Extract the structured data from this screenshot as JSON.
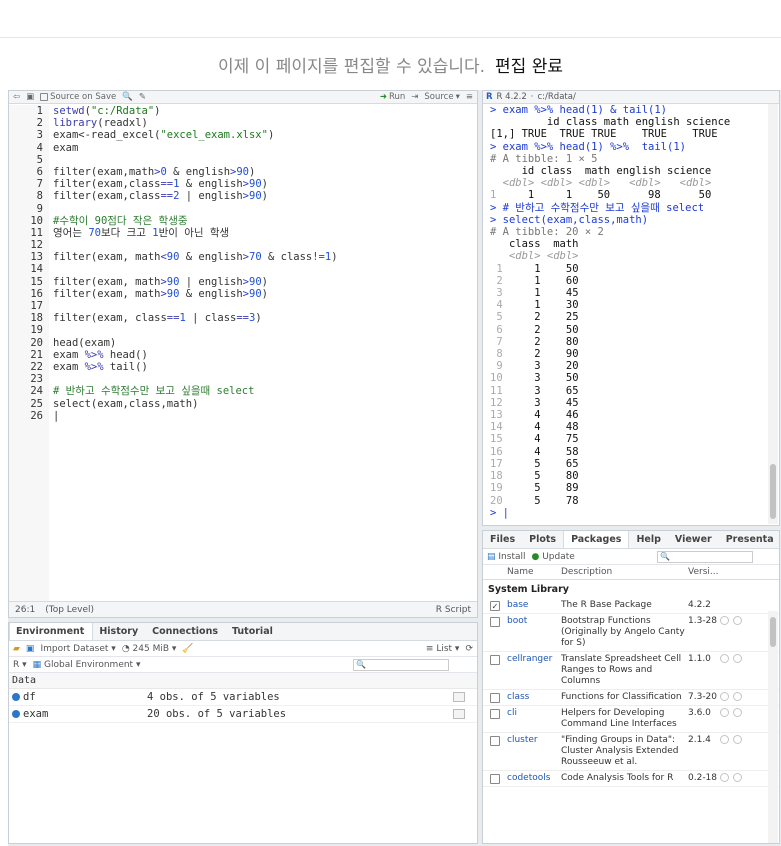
{
  "banner": {
    "message": "이제 이 페이지를 편집할 수 있습니다.",
    "done": "편집 완료"
  },
  "source": {
    "toolbar": {
      "source_on_save": "Source on Save",
      "run": "Run",
      "source": "Source"
    },
    "line_numbers": [
      "1",
      "2",
      "3",
      "4",
      "5",
      "6",
      "7",
      "8",
      "9",
      "10",
      "11",
      "12",
      "13",
      "14",
      "15",
      "16",
      "17",
      "18",
      "19",
      "20",
      "21",
      "22",
      "23",
      "24",
      "25",
      "26"
    ],
    "status": {
      "position": "26:1",
      "scope": "(Top Level)",
      "type": "R Script"
    }
  },
  "environment": {
    "tabs": [
      "Environment",
      "History",
      "Connections",
      "Tutorial"
    ],
    "import_dataset": "Import Dataset",
    "memory": "245 MiB",
    "list_view": "List",
    "r_label": "R",
    "scope": "Global Environment",
    "section": "Data",
    "rows": [
      {
        "name": "df",
        "value": "4 obs. of 5 variables"
      },
      {
        "name": "exam",
        "value": "20 obs. of 5 variables"
      }
    ]
  },
  "console": {
    "version": "R 4.2.2",
    "path": "c:/Rdata/"
  },
  "packages": {
    "tabs": [
      "Files",
      "Plots",
      "Packages",
      "Help",
      "Viewer",
      "Presenta"
    ],
    "install": "Install",
    "update": "Update",
    "columns": [
      "Name",
      "Description",
      "Versi..."
    ],
    "section": "System Library",
    "rows": [
      {
        "checked": true,
        "name": "base",
        "desc": "The R Base Package",
        "ver": "4.2.2"
      },
      {
        "checked": false,
        "name": "boot",
        "desc": "Bootstrap Functions (Originally by Angelo Canty for S)",
        "ver": "1.3-28"
      },
      {
        "checked": false,
        "name": "cellranger",
        "desc": "Translate Spreadsheet Cell Ranges to Rows and Columns",
        "ver": "1.1.0"
      },
      {
        "checked": false,
        "name": "class",
        "desc": "Functions for Classification",
        "ver": "7.3-20"
      },
      {
        "checked": false,
        "name": "cli",
        "desc": "Helpers for Developing Command Line Interfaces",
        "ver": "3.6.0"
      },
      {
        "checked": false,
        "name": "cluster",
        "desc": "\"Finding Groups in Data\": Cluster Analysis Extended Rousseeuw et al.",
        "ver": "2.1.4"
      },
      {
        "checked": false,
        "name": "codetools",
        "desc": "Code Analysis Tools for R",
        "ver": "0.2-18"
      }
    ]
  }
}
